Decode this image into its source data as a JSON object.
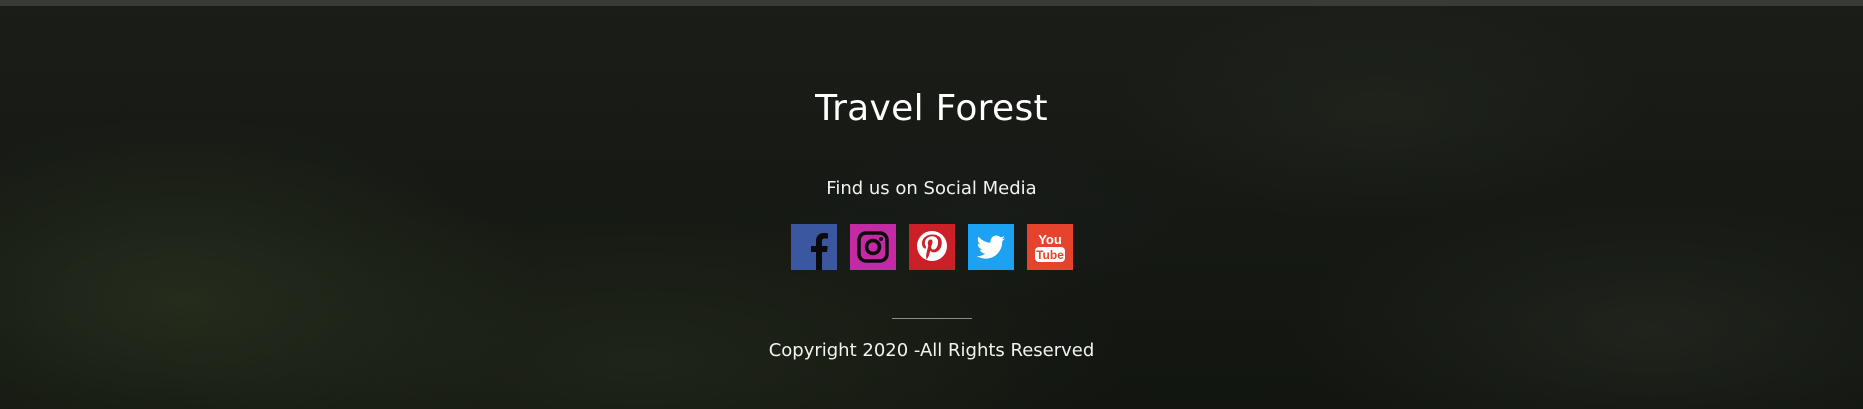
{
  "footer": {
    "title": "Travel Forest",
    "social_heading": "Find us on Social Media",
    "social_links": [
      {
        "network": "Facebook",
        "icon": "facebook-icon",
        "color": "#3b57a0"
      },
      {
        "network": "Instagram",
        "icon": "instagram-icon",
        "color": "#c32aa3"
      },
      {
        "network": "Pinterest",
        "icon": "pinterest-icon",
        "color": "#cb2027"
      },
      {
        "network": "Twitter",
        "icon": "twitter-icon",
        "color": "#1da1f2"
      },
      {
        "network": "YouTube",
        "icon": "youtube-icon",
        "color": "#e5432e"
      }
    ],
    "youtube_logo_text": {
      "line1": "You",
      "line2": "Tube"
    },
    "copyright": "Copyright 2020 -All Rights Reserved"
  },
  "colors": {
    "background": "#141713",
    "text": "#ffffff",
    "divider": "#8a8c88"
  }
}
